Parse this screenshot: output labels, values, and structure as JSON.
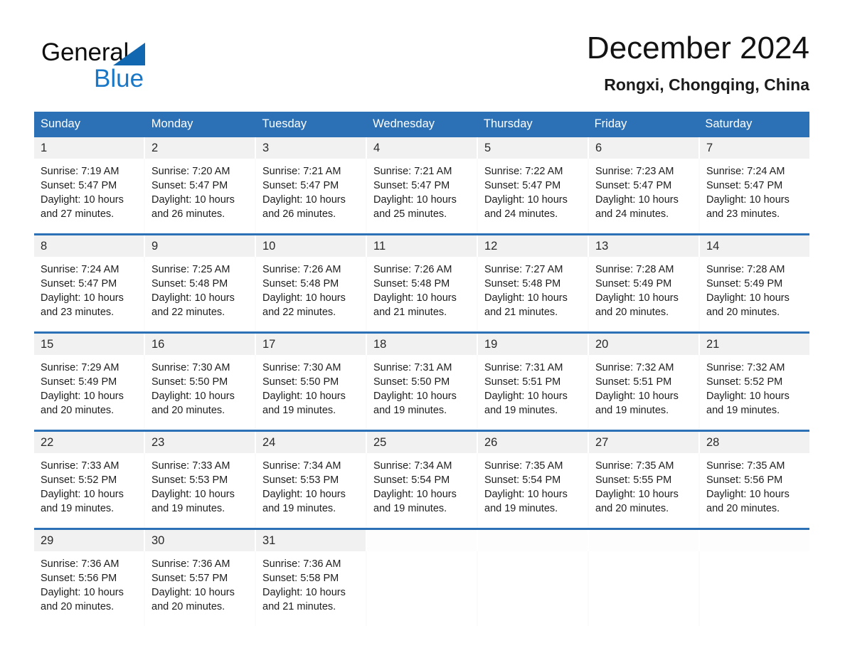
{
  "brand": {
    "logo_text_1": "General",
    "logo_text_2": "Blue",
    "triangle_color": "#1168b0",
    "blue_text_color": "#1877c7"
  },
  "header": {
    "month_title": "December 2024",
    "location": "Rongxi, Chongqing, China"
  },
  "theme": {
    "header_bar_color": "#2c71b5",
    "daynum_band_color": "#f1f1f1",
    "row_divider_color": "#2c71b5"
  },
  "calendar": {
    "day_headers": [
      "Sunday",
      "Monday",
      "Tuesday",
      "Wednesday",
      "Thursday",
      "Friday",
      "Saturday"
    ],
    "weeks": [
      [
        {
          "day": "1",
          "sunrise": "Sunrise: 7:19 AM",
          "sunset": "Sunset: 5:47 PM",
          "daylight_1": "Daylight: 10 hours",
          "daylight_2": "and 27 minutes."
        },
        {
          "day": "2",
          "sunrise": "Sunrise: 7:20 AM",
          "sunset": "Sunset: 5:47 PM",
          "daylight_1": "Daylight: 10 hours",
          "daylight_2": "and 26 minutes."
        },
        {
          "day": "3",
          "sunrise": "Sunrise: 7:21 AM",
          "sunset": "Sunset: 5:47 PM",
          "daylight_1": "Daylight: 10 hours",
          "daylight_2": "and 26 minutes."
        },
        {
          "day": "4",
          "sunrise": "Sunrise: 7:21 AM",
          "sunset": "Sunset: 5:47 PM",
          "daylight_1": "Daylight: 10 hours",
          "daylight_2": "and 25 minutes."
        },
        {
          "day": "5",
          "sunrise": "Sunrise: 7:22 AM",
          "sunset": "Sunset: 5:47 PM",
          "daylight_1": "Daylight: 10 hours",
          "daylight_2": "and 24 minutes."
        },
        {
          "day": "6",
          "sunrise": "Sunrise: 7:23 AM",
          "sunset": "Sunset: 5:47 PM",
          "daylight_1": "Daylight: 10 hours",
          "daylight_2": "and 24 minutes."
        },
        {
          "day": "7",
          "sunrise": "Sunrise: 7:24 AM",
          "sunset": "Sunset: 5:47 PM",
          "daylight_1": "Daylight: 10 hours",
          "daylight_2": "and 23 minutes."
        }
      ],
      [
        {
          "day": "8",
          "sunrise": "Sunrise: 7:24 AM",
          "sunset": "Sunset: 5:47 PM",
          "daylight_1": "Daylight: 10 hours",
          "daylight_2": "and 23 minutes."
        },
        {
          "day": "9",
          "sunrise": "Sunrise: 7:25 AM",
          "sunset": "Sunset: 5:48 PM",
          "daylight_1": "Daylight: 10 hours",
          "daylight_2": "and 22 minutes."
        },
        {
          "day": "10",
          "sunrise": "Sunrise: 7:26 AM",
          "sunset": "Sunset: 5:48 PM",
          "daylight_1": "Daylight: 10 hours",
          "daylight_2": "and 22 minutes."
        },
        {
          "day": "11",
          "sunrise": "Sunrise: 7:26 AM",
          "sunset": "Sunset: 5:48 PM",
          "daylight_1": "Daylight: 10 hours",
          "daylight_2": "and 21 minutes."
        },
        {
          "day": "12",
          "sunrise": "Sunrise: 7:27 AM",
          "sunset": "Sunset: 5:48 PM",
          "daylight_1": "Daylight: 10 hours",
          "daylight_2": "and 21 minutes."
        },
        {
          "day": "13",
          "sunrise": "Sunrise: 7:28 AM",
          "sunset": "Sunset: 5:49 PM",
          "daylight_1": "Daylight: 10 hours",
          "daylight_2": "and 20 minutes."
        },
        {
          "day": "14",
          "sunrise": "Sunrise: 7:28 AM",
          "sunset": "Sunset: 5:49 PM",
          "daylight_1": "Daylight: 10 hours",
          "daylight_2": "and 20 minutes."
        }
      ],
      [
        {
          "day": "15",
          "sunrise": "Sunrise: 7:29 AM",
          "sunset": "Sunset: 5:49 PM",
          "daylight_1": "Daylight: 10 hours",
          "daylight_2": "and 20 minutes."
        },
        {
          "day": "16",
          "sunrise": "Sunrise: 7:30 AM",
          "sunset": "Sunset: 5:50 PM",
          "daylight_1": "Daylight: 10 hours",
          "daylight_2": "and 20 minutes."
        },
        {
          "day": "17",
          "sunrise": "Sunrise: 7:30 AM",
          "sunset": "Sunset: 5:50 PM",
          "daylight_1": "Daylight: 10 hours",
          "daylight_2": "and 19 minutes."
        },
        {
          "day": "18",
          "sunrise": "Sunrise: 7:31 AM",
          "sunset": "Sunset: 5:50 PM",
          "daylight_1": "Daylight: 10 hours",
          "daylight_2": "and 19 minutes."
        },
        {
          "day": "19",
          "sunrise": "Sunrise: 7:31 AM",
          "sunset": "Sunset: 5:51 PM",
          "daylight_1": "Daylight: 10 hours",
          "daylight_2": "and 19 minutes."
        },
        {
          "day": "20",
          "sunrise": "Sunrise: 7:32 AM",
          "sunset": "Sunset: 5:51 PM",
          "daylight_1": "Daylight: 10 hours",
          "daylight_2": "and 19 minutes."
        },
        {
          "day": "21",
          "sunrise": "Sunrise: 7:32 AM",
          "sunset": "Sunset: 5:52 PM",
          "daylight_1": "Daylight: 10 hours",
          "daylight_2": "and 19 minutes."
        }
      ],
      [
        {
          "day": "22",
          "sunrise": "Sunrise: 7:33 AM",
          "sunset": "Sunset: 5:52 PM",
          "daylight_1": "Daylight: 10 hours",
          "daylight_2": "and 19 minutes."
        },
        {
          "day": "23",
          "sunrise": "Sunrise: 7:33 AM",
          "sunset": "Sunset: 5:53 PM",
          "daylight_1": "Daylight: 10 hours",
          "daylight_2": "and 19 minutes."
        },
        {
          "day": "24",
          "sunrise": "Sunrise: 7:34 AM",
          "sunset": "Sunset: 5:53 PM",
          "daylight_1": "Daylight: 10 hours",
          "daylight_2": "and 19 minutes."
        },
        {
          "day": "25",
          "sunrise": "Sunrise: 7:34 AM",
          "sunset": "Sunset: 5:54 PM",
          "daylight_1": "Daylight: 10 hours",
          "daylight_2": "and 19 minutes."
        },
        {
          "day": "26",
          "sunrise": "Sunrise: 7:35 AM",
          "sunset": "Sunset: 5:54 PM",
          "daylight_1": "Daylight: 10 hours",
          "daylight_2": "and 19 minutes."
        },
        {
          "day": "27",
          "sunrise": "Sunrise: 7:35 AM",
          "sunset": "Sunset: 5:55 PM",
          "daylight_1": "Daylight: 10 hours",
          "daylight_2": "and 20 minutes."
        },
        {
          "day": "28",
          "sunrise": "Sunrise: 7:35 AM",
          "sunset": "Sunset: 5:56 PM",
          "daylight_1": "Daylight: 10 hours",
          "daylight_2": "and 20 minutes."
        }
      ],
      [
        {
          "day": "29",
          "sunrise": "Sunrise: 7:36 AM",
          "sunset": "Sunset: 5:56 PM",
          "daylight_1": "Daylight: 10 hours",
          "daylight_2": "and 20 minutes."
        },
        {
          "day": "30",
          "sunrise": "Sunrise: 7:36 AM",
          "sunset": "Sunset: 5:57 PM",
          "daylight_1": "Daylight: 10 hours",
          "daylight_2": "and 20 minutes."
        },
        {
          "day": "31",
          "sunrise": "Sunrise: 7:36 AM",
          "sunset": "Sunset: 5:58 PM",
          "daylight_1": "Daylight: 10 hours",
          "daylight_2": "and 21 minutes."
        },
        {
          "day": "",
          "sunrise": "",
          "sunset": "",
          "daylight_1": "",
          "daylight_2": ""
        },
        {
          "day": "",
          "sunrise": "",
          "sunset": "",
          "daylight_1": "",
          "daylight_2": ""
        },
        {
          "day": "",
          "sunrise": "",
          "sunset": "",
          "daylight_1": "",
          "daylight_2": ""
        },
        {
          "day": "",
          "sunrise": "",
          "sunset": "",
          "daylight_1": "",
          "daylight_2": ""
        }
      ]
    ]
  }
}
